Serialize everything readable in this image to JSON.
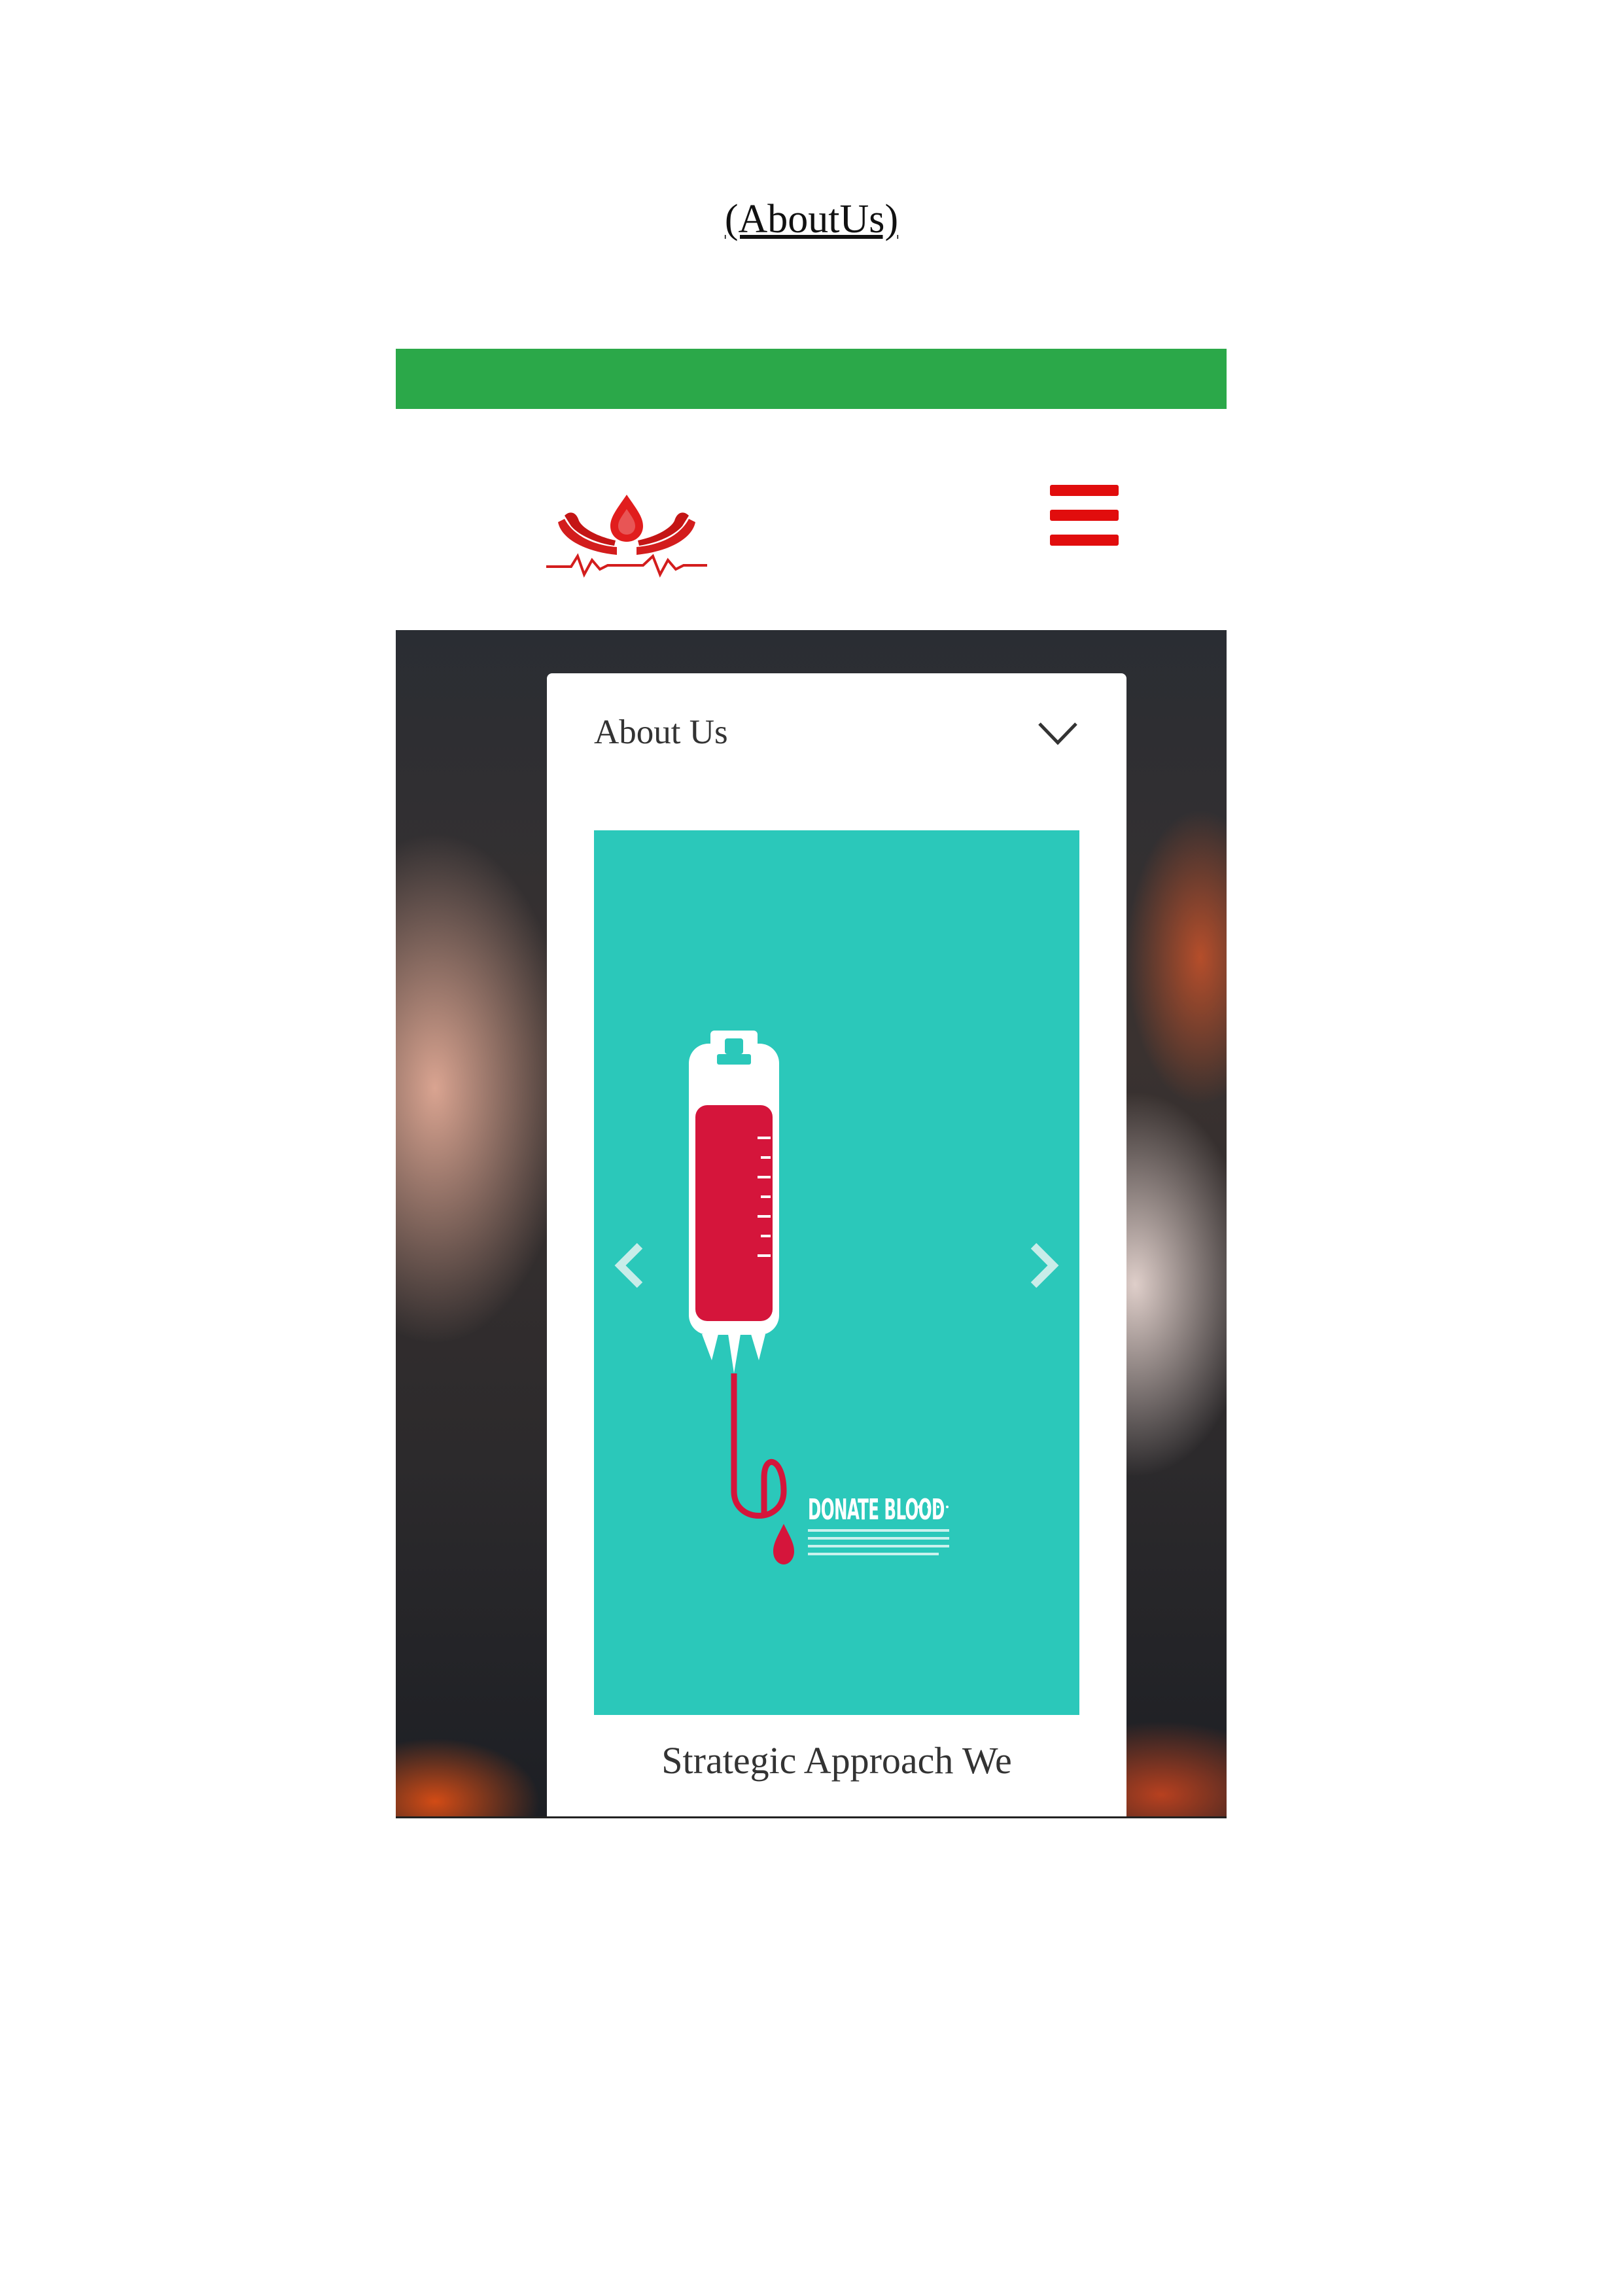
{
  "document": {
    "title": "(AboutUs)"
  },
  "header": {
    "logo_icon": "blood-donation-hands-logo",
    "menu_icon": "hamburger-menu-icon"
  },
  "colors": {
    "top_bar": "#2ba849",
    "brand_red": "#e10d0d",
    "slide_bg": "#2bc8ba",
    "blood": "#d5153b"
  },
  "card": {
    "title": "About Us",
    "toggle_icon": "chevron-down-icon",
    "slide": {
      "poster_text": "DONATE BLOOD",
      "prev_icon": "chevron-left-icon",
      "next_icon": "chevron-right-icon"
    },
    "caption": "Strategic Approach We"
  }
}
